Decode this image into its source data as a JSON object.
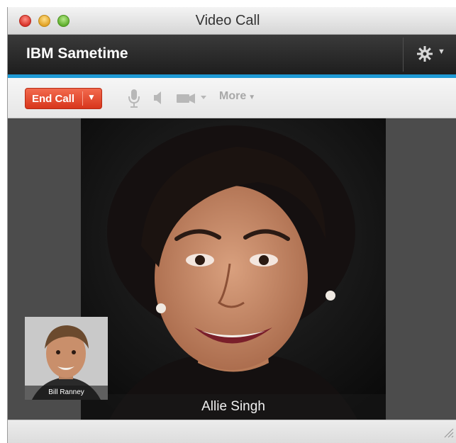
{
  "window": {
    "title": "Video Call"
  },
  "app": {
    "name": "IBM Sametime",
    "settings_icon": "gear-icon"
  },
  "toolbar": {
    "end_call_label": "End Call",
    "end_call_menu_icon": "chevron-down-icon",
    "mic_icon": "microphone-icon",
    "speaker_icon": "speaker-icon",
    "camera_icon": "video-camera-icon",
    "more_label": "More"
  },
  "call": {
    "remote_participant": "Allie Singh",
    "local_participant": "Bill Ranney"
  },
  "colors": {
    "accent_blue": "#1f9bd6",
    "end_call_red": "#e4472c",
    "header_dark": "#2a2a2a"
  }
}
